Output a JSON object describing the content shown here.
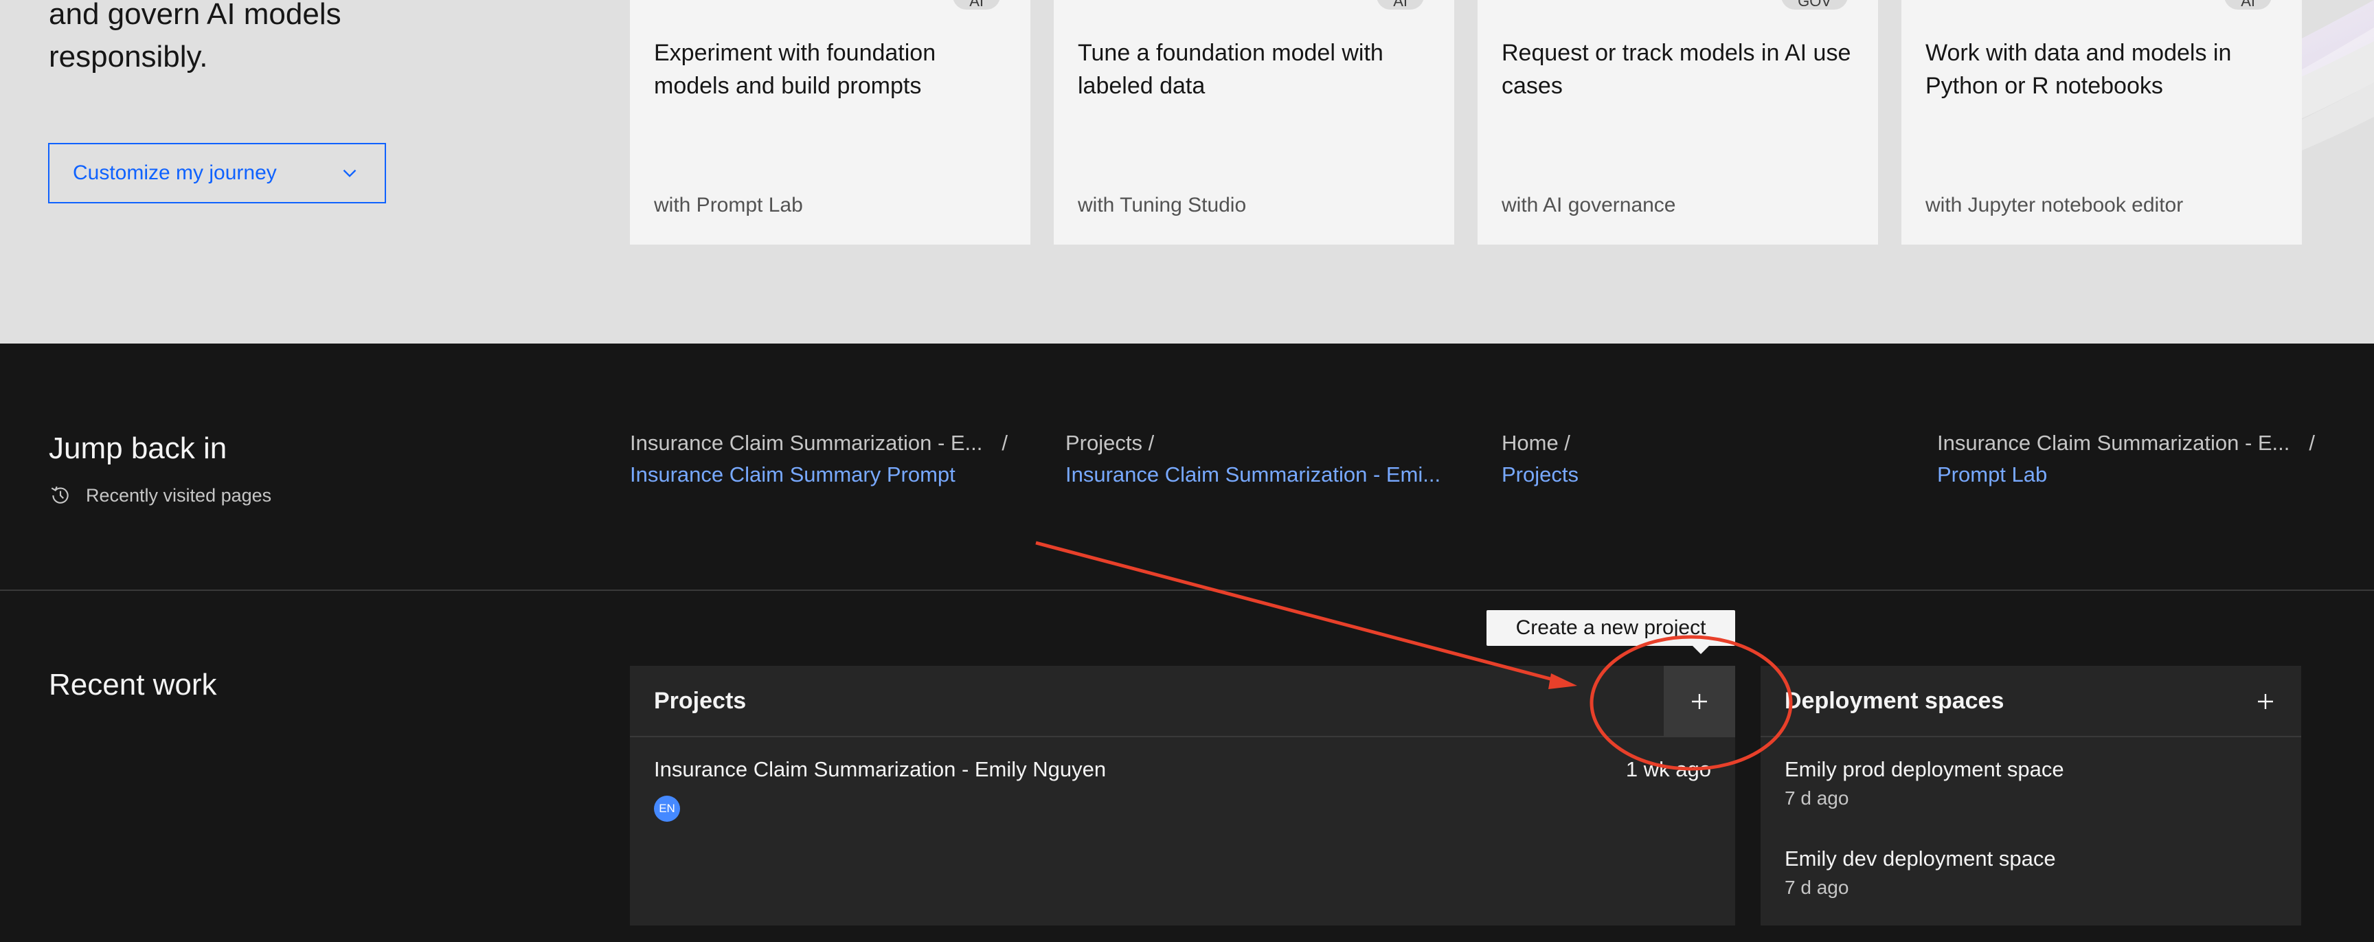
{
  "intro": {
    "lines": [
      "and govern AI models",
      "responsibly."
    ],
    "journey_button": "Customize my journey"
  },
  "cards": [
    {
      "tag": "AI",
      "title": "Experiment with foundation models and build prompts",
      "subtitle": "with Prompt Lab"
    },
    {
      "tag": "AI",
      "title": "Tune a foundation model with labeled data",
      "subtitle": "with Tuning Studio"
    },
    {
      "tag": "GOV",
      "title": "Request or track models in AI use cases",
      "subtitle": "with AI governance"
    },
    {
      "tag": "AI",
      "title": "Work with data and models in Python or R notebooks",
      "subtitle": "with Jupyter notebook editor"
    }
  ],
  "jump_back": {
    "title": "Jump back in",
    "recent_label": "Recently visited pages",
    "items": [
      {
        "crumb": "Insurance Claim Summarization - E...",
        "sep": "/",
        "link": "Insurance Claim Summary Prompt"
      },
      {
        "crumb": "Projects /",
        "sep": "",
        "link": "Insurance Claim Summarization - Emi..."
      },
      {
        "crumb": "Home /",
        "sep": "",
        "link": "Projects"
      },
      {
        "crumb": "Insurance Claim Summarization - E...",
        "sep": "/",
        "link": "Prompt Lab"
      }
    ]
  },
  "recent_work": {
    "title": "Recent work",
    "projects": {
      "title": "Projects",
      "tooltip": "Create a new project",
      "items": [
        {
          "name": "Insurance Claim Summarization - Emily Nguyen",
          "time": "1 wk ago",
          "initials": "EN"
        }
      ]
    },
    "spaces": {
      "title": "Deployment spaces",
      "items": [
        {
          "name": "Emily prod deployment space",
          "time": "7 d ago"
        },
        {
          "name": "Emily dev deployment space",
          "time": "7 d ago"
        }
      ]
    }
  },
  "colors": {
    "accent": "#0f62fe",
    "link": "#78a9ff",
    "annotation": "#e8402a"
  }
}
